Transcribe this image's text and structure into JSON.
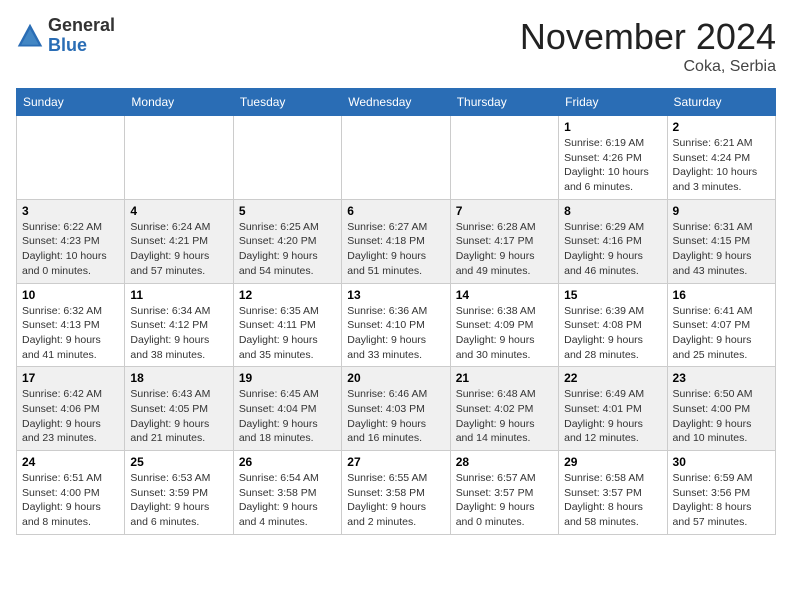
{
  "header": {
    "logo_general": "General",
    "logo_blue": "Blue",
    "month_title": "November 2024",
    "location": "Coka, Serbia"
  },
  "days_of_week": [
    "Sunday",
    "Monday",
    "Tuesday",
    "Wednesday",
    "Thursday",
    "Friday",
    "Saturday"
  ],
  "weeks": [
    [
      {
        "day": "",
        "info": ""
      },
      {
        "day": "",
        "info": ""
      },
      {
        "day": "",
        "info": ""
      },
      {
        "day": "",
        "info": ""
      },
      {
        "day": "",
        "info": ""
      },
      {
        "day": "1",
        "info": "Sunrise: 6:19 AM\nSunset: 4:26 PM\nDaylight: 10 hours\nand 6 minutes."
      },
      {
        "day": "2",
        "info": "Sunrise: 6:21 AM\nSunset: 4:24 PM\nDaylight: 10 hours\nand 3 minutes."
      }
    ],
    [
      {
        "day": "3",
        "info": "Sunrise: 6:22 AM\nSunset: 4:23 PM\nDaylight: 10 hours\nand 0 minutes."
      },
      {
        "day": "4",
        "info": "Sunrise: 6:24 AM\nSunset: 4:21 PM\nDaylight: 9 hours\nand 57 minutes."
      },
      {
        "day": "5",
        "info": "Sunrise: 6:25 AM\nSunset: 4:20 PM\nDaylight: 9 hours\nand 54 minutes."
      },
      {
        "day": "6",
        "info": "Sunrise: 6:27 AM\nSunset: 4:18 PM\nDaylight: 9 hours\nand 51 minutes."
      },
      {
        "day": "7",
        "info": "Sunrise: 6:28 AM\nSunset: 4:17 PM\nDaylight: 9 hours\nand 49 minutes."
      },
      {
        "day": "8",
        "info": "Sunrise: 6:29 AM\nSunset: 4:16 PM\nDaylight: 9 hours\nand 46 minutes."
      },
      {
        "day": "9",
        "info": "Sunrise: 6:31 AM\nSunset: 4:15 PM\nDaylight: 9 hours\nand 43 minutes."
      }
    ],
    [
      {
        "day": "10",
        "info": "Sunrise: 6:32 AM\nSunset: 4:13 PM\nDaylight: 9 hours\nand 41 minutes."
      },
      {
        "day": "11",
        "info": "Sunrise: 6:34 AM\nSunset: 4:12 PM\nDaylight: 9 hours\nand 38 minutes."
      },
      {
        "day": "12",
        "info": "Sunrise: 6:35 AM\nSunset: 4:11 PM\nDaylight: 9 hours\nand 35 minutes."
      },
      {
        "day": "13",
        "info": "Sunrise: 6:36 AM\nSunset: 4:10 PM\nDaylight: 9 hours\nand 33 minutes."
      },
      {
        "day": "14",
        "info": "Sunrise: 6:38 AM\nSunset: 4:09 PM\nDaylight: 9 hours\nand 30 minutes."
      },
      {
        "day": "15",
        "info": "Sunrise: 6:39 AM\nSunset: 4:08 PM\nDaylight: 9 hours\nand 28 minutes."
      },
      {
        "day": "16",
        "info": "Sunrise: 6:41 AM\nSunset: 4:07 PM\nDaylight: 9 hours\nand 25 minutes."
      }
    ],
    [
      {
        "day": "17",
        "info": "Sunrise: 6:42 AM\nSunset: 4:06 PM\nDaylight: 9 hours\nand 23 minutes."
      },
      {
        "day": "18",
        "info": "Sunrise: 6:43 AM\nSunset: 4:05 PM\nDaylight: 9 hours\nand 21 minutes."
      },
      {
        "day": "19",
        "info": "Sunrise: 6:45 AM\nSunset: 4:04 PM\nDaylight: 9 hours\nand 18 minutes."
      },
      {
        "day": "20",
        "info": "Sunrise: 6:46 AM\nSunset: 4:03 PM\nDaylight: 9 hours\nand 16 minutes."
      },
      {
        "day": "21",
        "info": "Sunrise: 6:48 AM\nSunset: 4:02 PM\nDaylight: 9 hours\nand 14 minutes."
      },
      {
        "day": "22",
        "info": "Sunrise: 6:49 AM\nSunset: 4:01 PM\nDaylight: 9 hours\nand 12 minutes."
      },
      {
        "day": "23",
        "info": "Sunrise: 6:50 AM\nSunset: 4:00 PM\nDaylight: 9 hours\nand 10 minutes."
      }
    ],
    [
      {
        "day": "24",
        "info": "Sunrise: 6:51 AM\nSunset: 4:00 PM\nDaylight: 9 hours\nand 8 minutes."
      },
      {
        "day": "25",
        "info": "Sunrise: 6:53 AM\nSunset: 3:59 PM\nDaylight: 9 hours\nand 6 minutes."
      },
      {
        "day": "26",
        "info": "Sunrise: 6:54 AM\nSunset: 3:58 PM\nDaylight: 9 hours\nand 4 minutes."
      },
      {
        "day": "27",
        "info": "Sunrise: 6:55 AM\nSunset: 3:58 PM\nDaylight: 9 hours\nand 2 minutes."
      },
      {
        "day": "28",
        "info": "Sunrise: 6:57 AM\nSunset: 3:57 PM\nDaylight: 9 hours\nand 0 minutes."
      },
      {
        "day": "29",
        "info": "Sunrise: 6:58 AM\nSunset: 3:57 PM\nDaylight: 8 hours\nand 58 minutes."
      },
      {
        "day": "30",
        "info": "Sunrise: 6:59 AM\nSunset: 3:56 PM\nDaylight: 8 hours\nand 57 minutes."
      }
    ]
  ]
}
